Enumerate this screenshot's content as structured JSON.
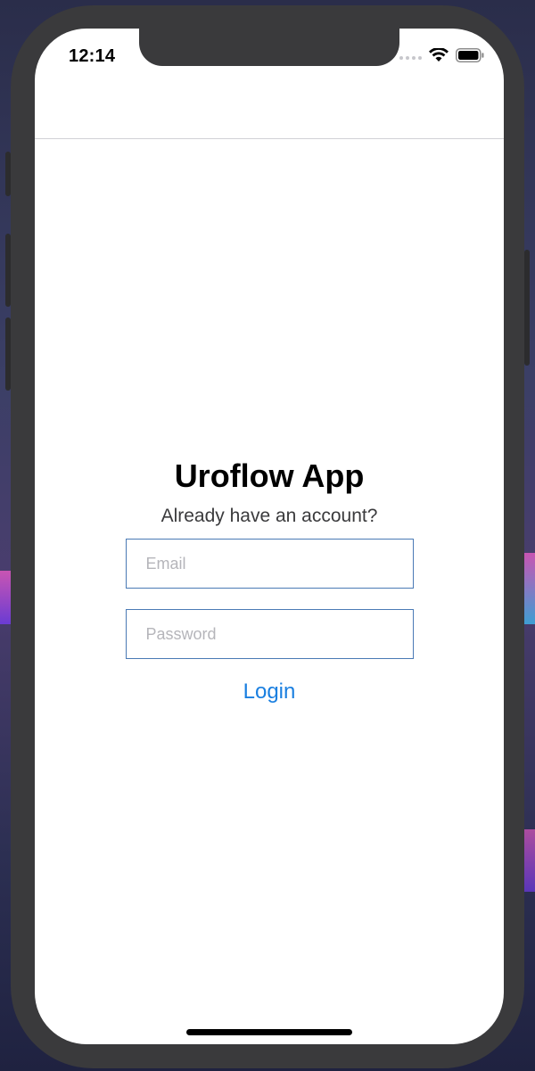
{
  "status_bar": {
    "time": "12:14",
    "signal_icon": "signal-dots-icon",
    "wifi_icon": "wifi-icon",
    "battery_icon": "battery-icon"
  },
  "login": {
    "title": "Uroflow App",
    "subtitle": "Already have an account?",
    "email_placeholder": "Email",
    "email_value": "",
    "password_placeholder": "Password",
    "password_value": "",
    "login_label": "Login"
  },
  "colors": {
    "accent": "#1a7fe0",
    "field_border": "#4a7ab5",
    "device_frame": "#3a3a3c"
  }
}
